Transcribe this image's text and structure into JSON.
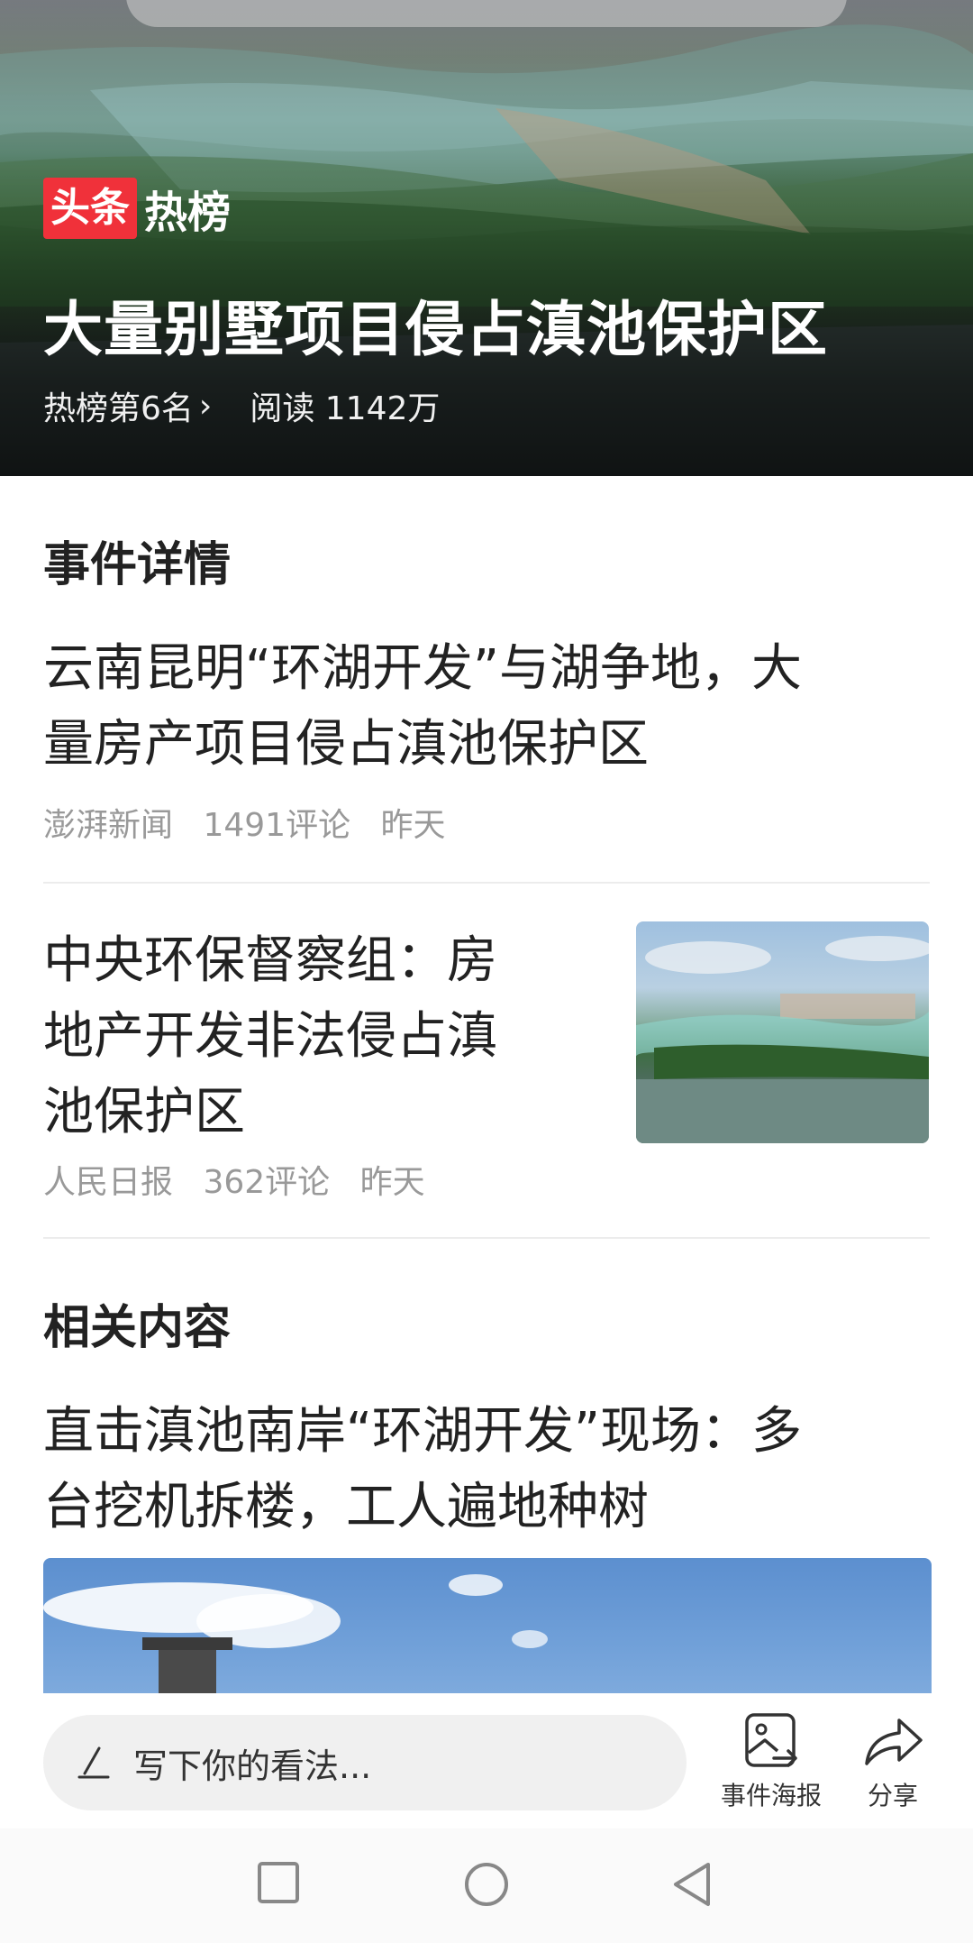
{
  "hero": {
    "badge_red": "头条",
    "badge_white": "热榜",
    "title": "大量别墅项目侵占滇池保护区",
    "rank": "热榜第6名",
    "reads": "阅读 1142万"
  },
  "event": {
    "heading": "事件详情",
    "items": [
      {
        "title_line1": "云南昆明“环湖开发”与湖争地，大",
        "title_line2": "量房产项目侵占滇池保护区",
        "source": "澎湃新闻",
        "comments": "1491评论",
        "time": "昨天"
      },
      {
        "title_line1": "中央环保督察组：房",
        "title_line2": "地产开发非法侵占滇",
        "title_line3": "池保护区",
        "source": "人民日报",
        "comments": "362评论",
        "time": "昨天"
      }
    ]
  },
  "related": {
    "heading": "相关内容",
    "items": [
      {
        "title_line1": "直击滇池南岸“环湖开发”现场：多",
        "title_line2": "台挖机拆楼，工人遍地种树"
      }
    ]
  },
  "bottom_bar": {
    "comment_placeholder": "写下你的看法...",
    "poster_label": "事件海报",
    "share_label": "分享"
  },
  "colors": {
    "badge_red": "#f0313a",
    "meta_gray": "#999999"
  },
  "icons": [
    "pen-icon",
    "poster-icon",
    "share-icon",
    "nav-recents-icon",
    "nav-home-icon",
    "nav-back-icon"
  ]
}
